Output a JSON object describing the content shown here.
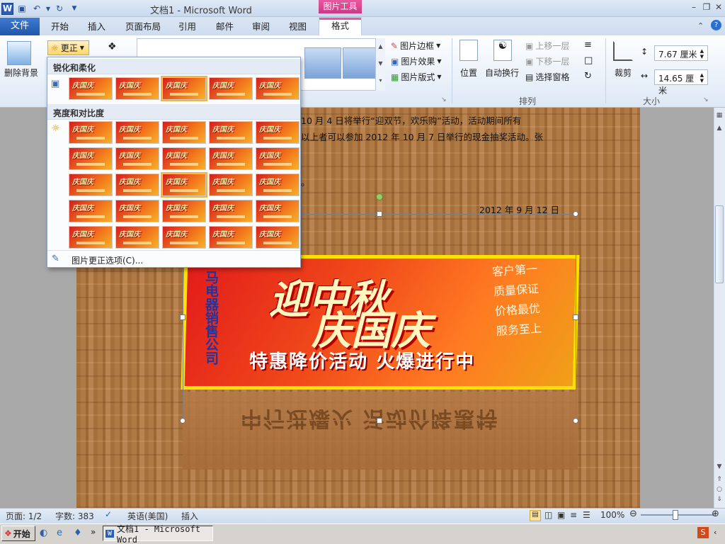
{
  "window": {
    "title": "文档1 - Microsoft Word",
    "context_tab_group": "图片工具"
  },
  "tabs": [
    "文件",
    "开始",
    "插入",
    "页面布局",
    "引用",
    "邮件",
    "审阅",
    "视图",
    "格式"
  ],
  "ribbon": {
    "remove_bg": "删除背景",
    "correct": "更正",
    "picture_border": "图片边框",
    "picture_effects": "图片效果",
    "picture_layout": "图片版式",
    "position": "位置",
    "wrap_text": "自动换行",
    "bring_forward": "上移一层",
    "send_backward": "下移一层",
    "selection_pane": "选择窗格",
    "arrange_label": "排列",
    "crop": "裁剪",
    "height": "7.67 厘米",
    "width": "14.65 厘米",
    "size_label": "大小"
  },
  "dropdown": {
    "section1": "锐化和柔化",
    "section2": "亮度和对比度",
    "options_link": "图片更正选项(C)..."
  },
  "document": {
    "line1": "10 月 4 日将举行“迎双节，欢乐购”活动，活动期间所有",
    "line2": "以上者可以参加 2012 年 10 月 7 日举行的现金抽奖活动。张",
    "period": "。",
    "date": "2012 年 9 月 12 日",
    "banner": {
      "title_line1": "迎中秋",
      "title_line2": "庆国庆",
      "subtitle": "特惠降价活动 火爆进行中",
      "company": "马电器销售公司",
      "slogans": [
        "客户第一",
        "质量保证",
        "价格最优",
        "服务至上"
      ],
      "reflection": "中行进爆火 活动价降惠特"
    }
  },
  "status": {
    "page": "页面: 1/2",
    "words": "字数: 383",
    "language": "英语(美国)",
    "mode": "插入",
    "zoom": "100%"
  },
  "taskbar": {
    "start": "开始",
    "word_task": "文档1 - Microsoft Word"
  },
  "colors": {
    "file_tab": "#2b5fb4",
    "context_tab": "#d6458f",
    "selected_preset": "#f1b642"
  }
}
